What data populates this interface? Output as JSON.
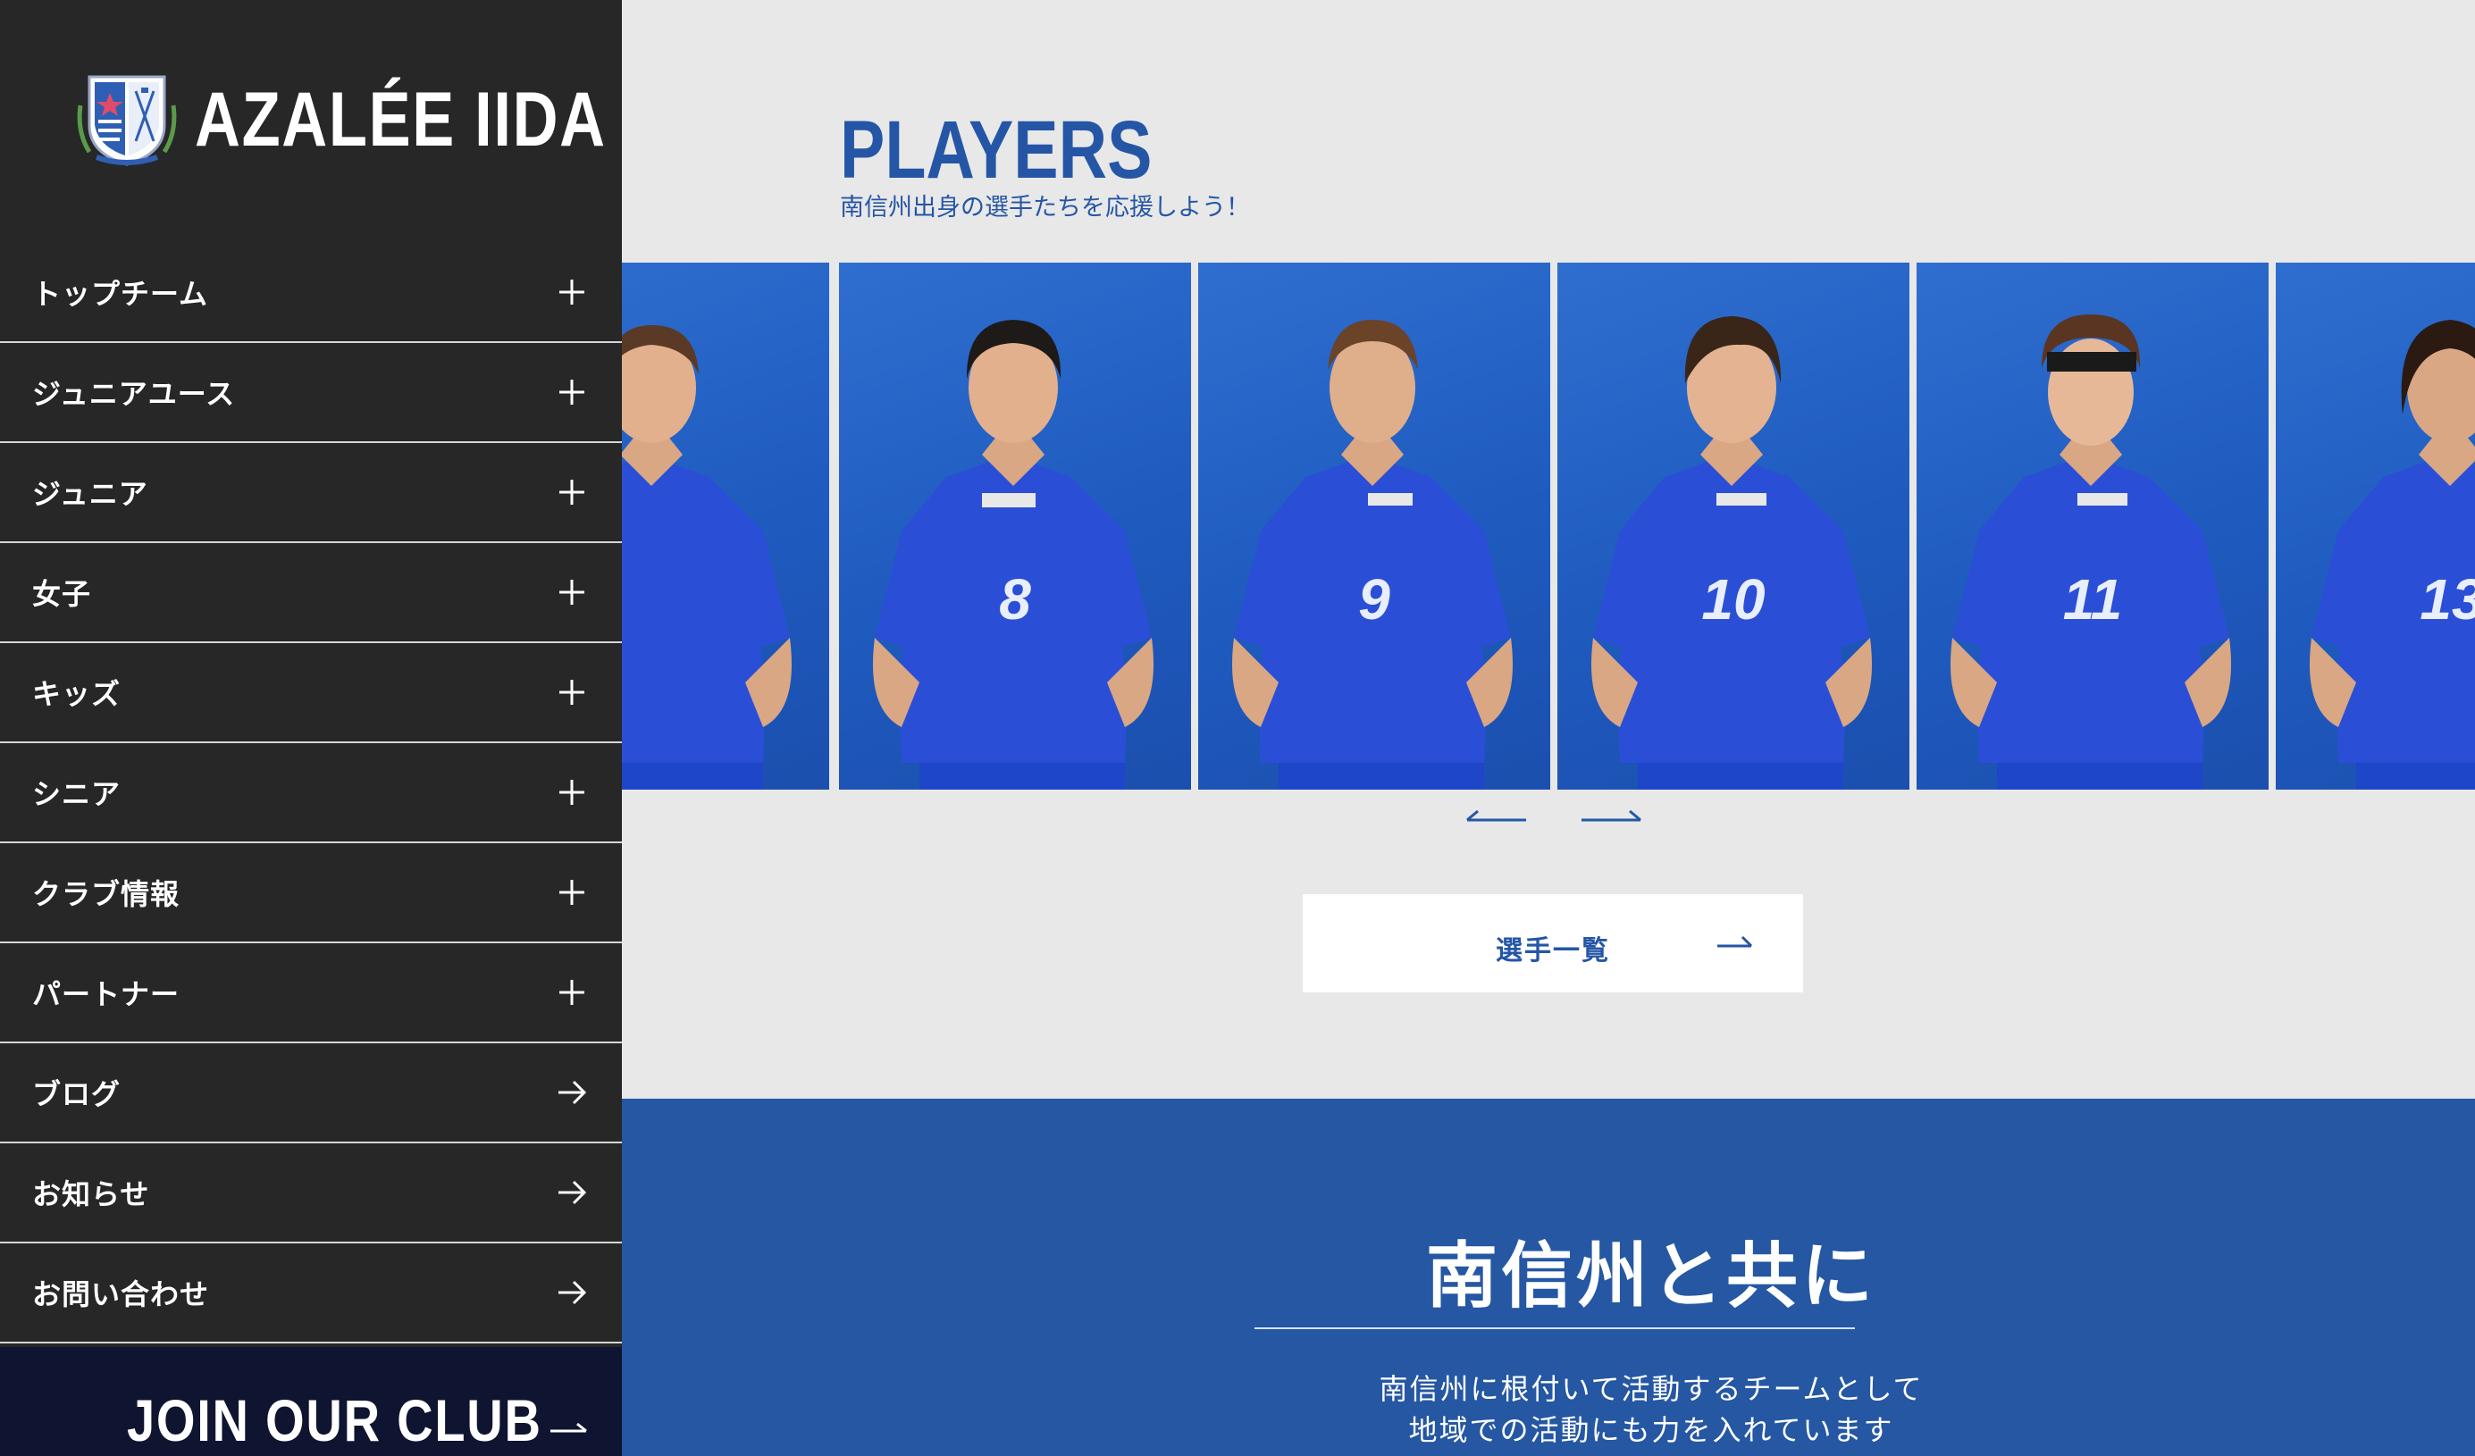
{
  "sidebar": {
    "logo_text": "AZALÉE IIDA",
    "menu": [
      {
        "label": "トップチーム",
        "icon": "plus-icon"
      },
      {
        "label": "ジュニアユース",
        "icon": "plus-icon"
      },
      {
        "label": "ジュニア",
        "icon": "plus-icon"
      },
      {
        "label": "女子",
        "icon": "plus-icon"
      },
      {
        "label": "キッズ",
        "icon": "plus-icon"
      },
      {
        "label": "シニア",
        "icon": "plus-icon"
      },
      {
        "label": "クラブ情報",
        "icon": "plus-icon"
      },
      {
        "label": "パートナー",
        "icon": "plus-icon"
      },
      {
        "label": "ブログ",
        "icon": "arrow-right-icon"
      },
      {
        "label": "お知らせ",
        "icon": "arrow-right-icon"
      },
      {
        "label": "お問い合わせ",
        "icon": "arrow-right-icon"
      }
    ],
    "join_label": "JOIN OUR CLUB"
  },
  "players": {
    "title": "PLAYERS",
    "subtitle": "南信州出身の選手たちを応援しよう！",
    "cards": [
      {
        "number": ""
      },
      {
        "number": "8"
      },
      {
        "number": "9"
      },
      {
        "number": "10"
      },
      {
        "number": "11"
      },
      {
        "number": "13"
      }
    ],
    "list_button": "選手一覧"
  },
  "community": {
    "title": "南信州と共に",
    "line1": "南信州に根付いて活動するチームとして",
    "line2": "地域での活動にも力を入れています"
  },
  "colors": {
    "sidebar_bg": "#272727",
    "accent_blue": "#2556a6",
    "section_blue": "#2557a3",
    "join_bg": "#0f1530",
    "page_bg": "#e8e8e8"
  }
}
